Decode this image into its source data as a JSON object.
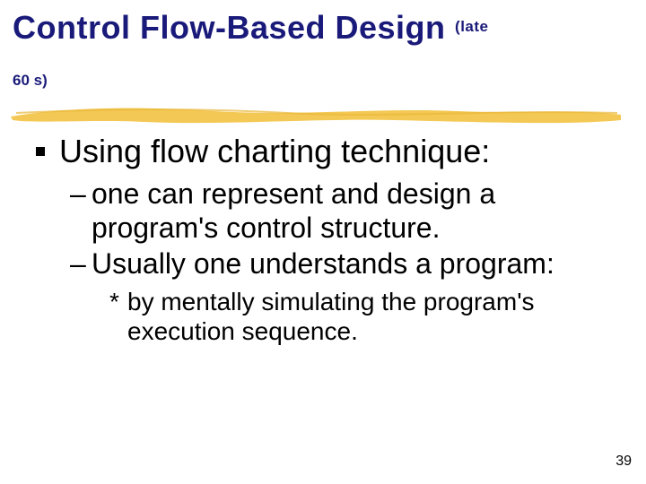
{
  "title": {
    "main": "Control Flow-Based Design",
    "sub_inline": "(late",
    "sub_line2": "60 s)"
  },
  "bullets": {
    "lvl1": "Using  flow charting technique:",
    "lvl2a": "one can represent and design a program's control structure.",
    "lvl2b": "Usually one understands a program:",
    "lvl3": "by mentally simulating the program's execution sequence."
  },
  "page_number": "39"
}
